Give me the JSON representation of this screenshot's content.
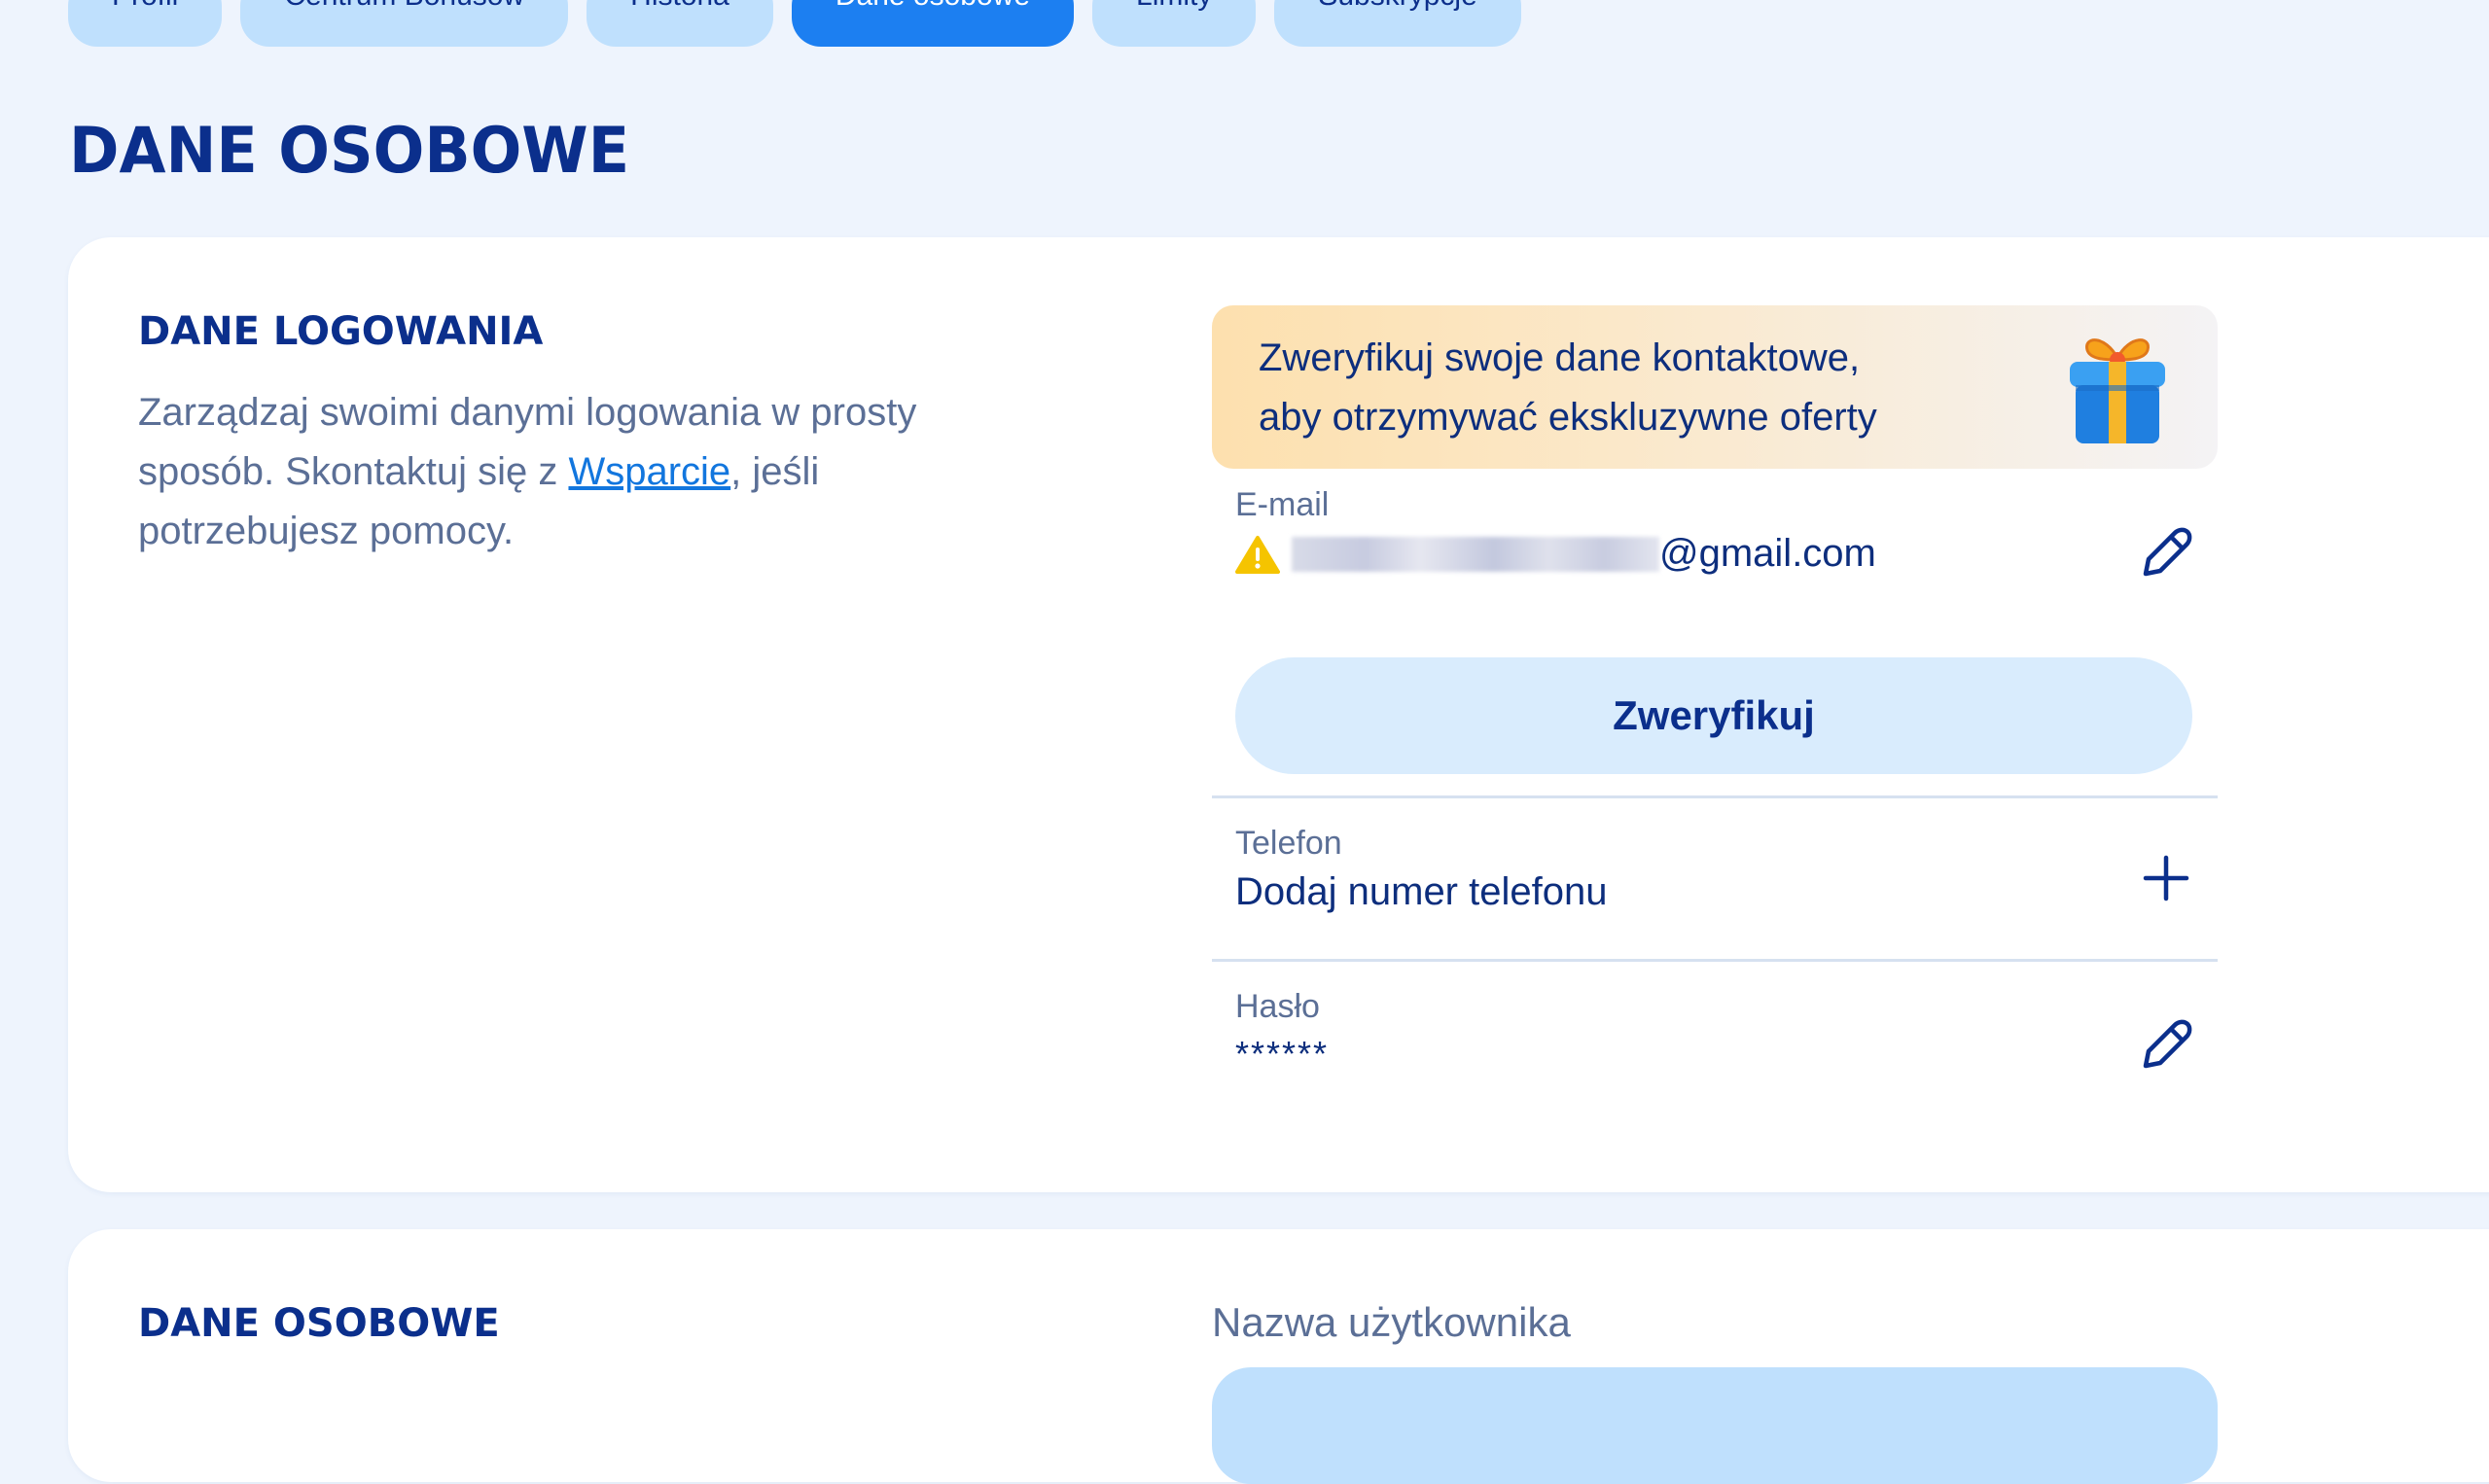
{
  "tabs": [
    {
      "label": "Profil",
      "active": false
    },
    {
      "label": "Centrum Bonusów",
      "active": false
    },
    {
      "label": "Historia",
      "active": false
    },
    {
      "label": "Dane osobowe",
      "active": true
    },
    {
      "label": "Limity",
      "active": false
    },
    {
      "label": "Subskrypcje",
      "active": false
    }
  ],
  "page_title": "DANE OSOBOWE",
  "login_section": {
    "title": "DANE LOGOWANIA",
    "desc_before": "Zarządzaj swoimi danymi logowania w prosty sposób. Skontaktuj się z ",
    "desc_link": "Wsparcie",
    "desc_after": ", jeśli potrzebujesz pomocy."
  },
  "banner": {
    "line1": "Zweryfikuj swoje dane kontaktowe,",
    "line2": "aby otrzymywać ekskluzywne oferty",
    "icon": "gift-icon"
  },
  "email": {
    "label": "E-mail",
    "value_suffix": "@gmail.com",
    "warning_icon": "warning-icon",
    "edit_icon": "pencil-icon"
  },
  "verify_button": "Zweryfikuj",
  "phone": {
    "label": "Telefon",
    "value": "Dodaj numer telefonu",
    "add_icon": "plus-icon"
  },
  "password": {
    "label": "Hasło",
    "value": "******",
    "edit_icon": "pencil-icon"
  },
  "personal_section": {
    "title": "DANE OSOBOWE",
    "username_label": "Nazwa użytkownika"
  },
  "colors": {
    "primary": "#0b2f8c",
    "accent": "#1c7ff1",
    "tab_bg": "#bfe0fd",
    "background": "#eef4fd",
    "warning": "#f5c400"
  }
}
